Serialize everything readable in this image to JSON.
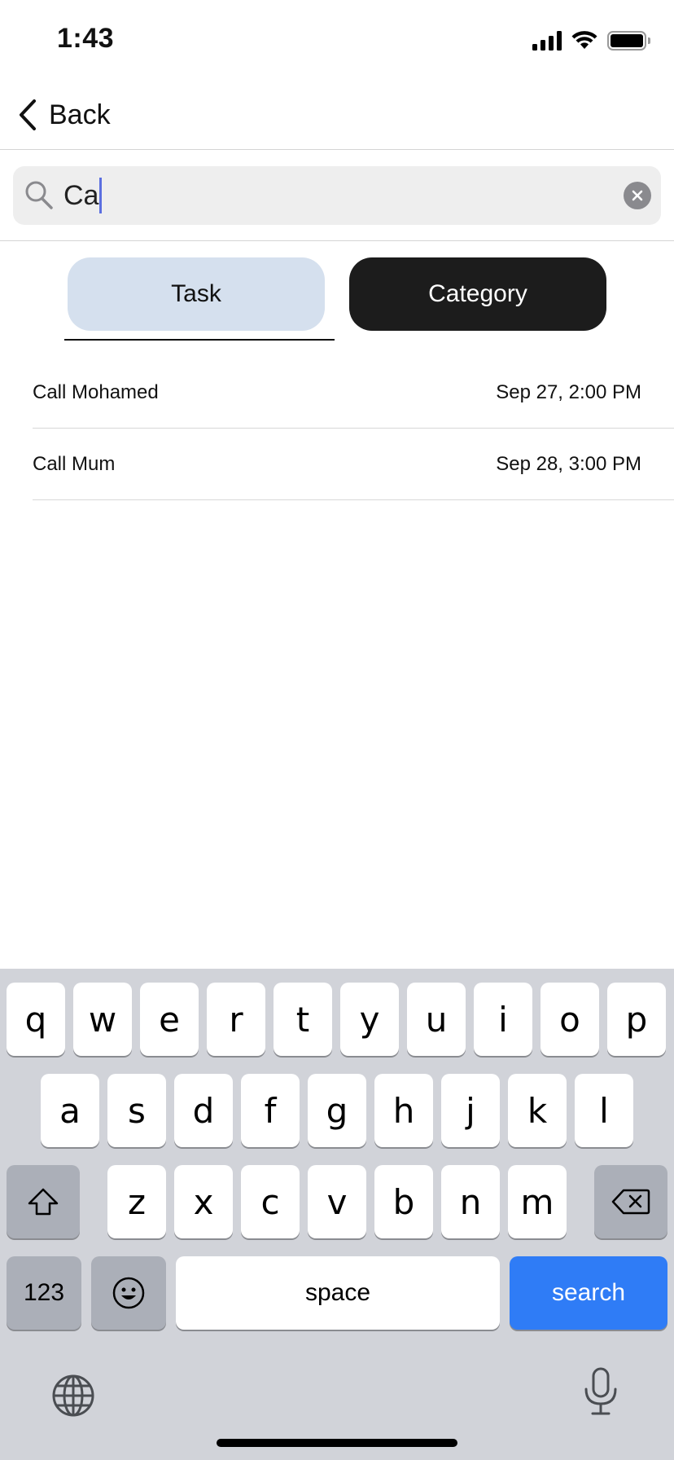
{
  "status_bar": {
    "time": "1:43"
  },
  "nav": {
    "back_label": "Back"
  },
  "search": {
    "value": "Ca"
  },
  "tabs": [
    {
      "label": "Task",
      "selected": true
    },
    {
      "label": "Category",
      "selected": false
    }
  ],
  "results": [
    {
      "title": "Call Mohamed",
      "date": "Sep 27, 2:00 PM"
    },
    {
      "title": "Call Mum",
      "date": "Sep 28, 3:00 PM"
    }
  ],
  "keyboard": {
    "row1": [
      "q",
      "w",
      "e",
      "r",
      "t",
      "y",
      "u",
      "i",
      "o",
      "p"
    ],
    "row2": [
      "a",
      "s",
      "d",
      "f",
      "g",
      "h",
      "j",
      "k",
      "l"
    ],
    "row3": [
      "z",
      "x",
      "c",
      "v",
      "b",
      "n",
      "m"
    ],
    "numbers_label": "123",
    "space_label": "space",
    "search_label": "search"
  },
  "colors": {
    "accent_blue": "#2f7cf6",
    "task_tab_bg": "#d5e0ee",
    "category_tab_bg": "#1c1c1c",
    "keyboard_bg": "#d1d3d9"
  },
  "icons": [
    "cellular-signal-icon",
    "wifi-icon",
    "battery-icon",
    "chevron-left-icon",
    "search-icon",
    "clear-icon",
    "shift-icon",
    "backspace-icon",
    "emoji-icon",
    "globe-icon",
    "microphone-icon"
  ]
}
